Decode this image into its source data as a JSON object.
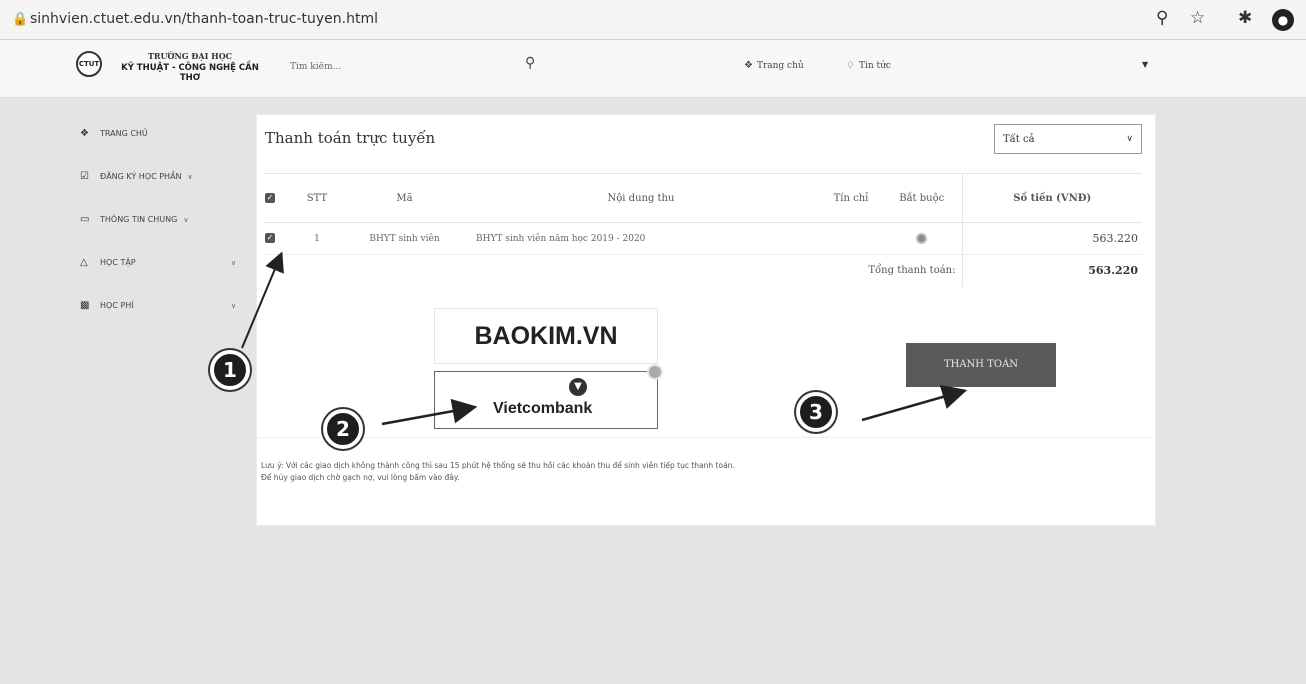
{
  "browser": {
    "url": "sinhvien.ctuet.edu.vn/thanh-toan-truc-tuyen.html",
    "icons": [
      "lock-icon",
      "zoom-icon",
      "star-icon",
      "extensions-icon",
      "profile-icon"
    ]
  },
  "header": {
    "logo_emblem": "CTUT",
    "logo_line1": "TRƯỜNG ĐẠI HỌC",
    "logo_line2": "KỸ THUẬT - CÔNG NGHỆ CẦN THƠ",
    "search_placeholder": "Tìm kiếm...",
    "nav": [
      {
        "label": "Trang chủ",
        "icon": "home-icon"
      },
      {
        "label": "Tin tức",
        "icon": "bell-icon"
      }
    ]
  },
  "sidebar": {
    "items": [
      {
        "label": "TRANG CHỦ",
        "icon": "home-icon"
      },
      {
        "label": "ĐĂNG KÝ HỌC PHẦN",
        "icon": "checkbox-icon"
      },
      {
        "label": "THÔNG TIN CHUNG",
        "icon": "monitor-icon"
      },
      {
        "label": "HỌC TẬP",
        "icon": "graduation-cap-icon"
      },
      {
        "label": "HỌC PHÍ",
        "icon": "money-icon"
      }
    ]
  },
  "main": {
    "title": "Thanh toán trực tuyến",
    "filter": "Tất cả",
    "table": {
      "headers": [
        "STT",
        "Mã",
        "Nội dung thu",
        "Tín chỉ",
        "Bắt buộc",
        "Số tiền (VNĐ)"
      ],
      "rows": [
        {
          "stt": "1",
          "code": "BHYT sinh viên",
          "content": "BHYT sinh viên năm học 2019 - 2020",
          "credits": "",
          "amount": "563.220"
        }
      ],
      "total_label": "Tổng thanh toán:",
      "total_amount": "563.220"
    },
    "payment": {
      "baokim": "BAOKIM.VN",
      "vietcombank": "Vietcombank",
      "pay_button": "THANH TOÁN"
    },
    "note_line1": "Lưu ý: Với các giao dịch không thành công thì sau 15 phút hệ thống sẽ thu hồi các khoản thu để sinh viên tiếp tục thanh toán.",
    "note_line2": "Để hủy giao dịch chờ gạch nợ, vui lòng bấm vào đây."
  },
  "annotations": [
    "1",
    "2",
    "3"
  ]
}
